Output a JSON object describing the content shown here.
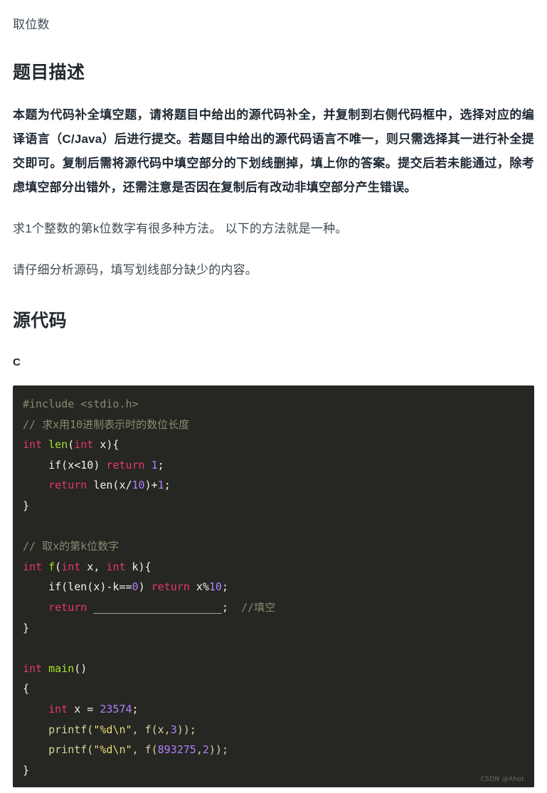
{
  "document": {
    "title": "取位数"
  },
  "sections": {
    "description_heading": "题目描述",
    "source_heading": "源代码"
  },
  "description": {
    "notice": "本题为代码补全填空题，请将题目中给出的源代码补全，并复制到右侧代码框中，选择对应的编译语言（C/Java）后进行提交。若题目中给出的源代码语言不唯一，则只需选择其一进行补全提交即可。复制后需将源代码中填空部分的下划线删掉，填上你的答案。提交后若未能通过，除考虑填空部分出错外，还需注意是否因在复制后有改动非填空部分产生错误。",
    "paragraph_1": "求1个整数的第k位数字有很多种方法。 以下的方法就是一种。",
    "paragraph_2": "请仔细分析源码，填写划线部分缺少的内容。"
  },
  "code": {
    "language_label": "C",
    "lines": {
      "l1_include": "#include <stdio.h>",
      "l2_comment": "// 求x用10进制表示时的数位长度",
      "l3_kw_int": "int",
      "l3_fn": "len",
      "l3_paren_open": "(",
      "l3_kw_int2": "int",
      "l3_param": " x){",
      "l4_if": "    if(x<10)",
      "l4_return": "return",
      "l4_num": "1",
      "l4_semi": ";",
      "l5_return": "    return",
      "l5_call": " len(x/",
      "l5_num": "10",
      "l5_tail": ")+",
      "l5_num2": "1",
      "l5_semi": ";",
      "l6_close": "}",
      "l8_comment": "// 取x的第k位数字",
      "l9_kw_int": "int",
      "l9_fn": "f",
      "l9_paren": "(",
      "l9_kw_int2": "int",
      "l9_x": " x, ",
      "l9_kw_int3": "int",
      "l9_k": " k){",
      "l10_if": "    if(len(x)-k==",
      "l10_num": "0",
      "l10_paren": ")",
      "l10_return": "return",
      "l10_expr": " x%",
      "l10_num2": "10",
      "l10_semi": ";",
      "l11_return": "    return",
      "l11_blank": " ____________________;",
      "l11_comment": "//填空",
      "l12_close": "}",
      "l14_kw_int": "int",
      "l14_fn": "main",
      "l14_paren": "()",
      "l15_brace": "{",
      "l16_kw_int": "    int",
      "l16_assign": " x = ",
      "l16_num": "23574",
      "l16_semi": ";",
      "l17_call": "    printf(",
      "l17_str": "\"%d\\n\"",
      "l17_args": ", f(x,",
      "l17_num": "3",
      "l17_tail": "));",
      "l18_call": "    printf(",
      "l18_str": "\"%d\\n\"",
      "l18_args": ", f(",
      "l18_num": "893275",
      "l18_comma": ",",
      "l18_num2": "2",
      "l18_tail": "));",
      "l19_close": "}"
    }
  },
  "watermark": {
    "text": "CSDN @Ahot"
  },
  "colors": {
    "page_background": "#ffffff",
    "text": "#3f4a56",
    "heading": "#24292f",
    "code_background": "#262622",
    "token_keyword": "#e6376f",
    "token_function": "#a6e22e",
    "token_number": "#ae81ff",
    "token_string": "#e6db74",
    "token_comment": "#8a8a72",
    "token_plain": "#f2f2ec"
  }
}
